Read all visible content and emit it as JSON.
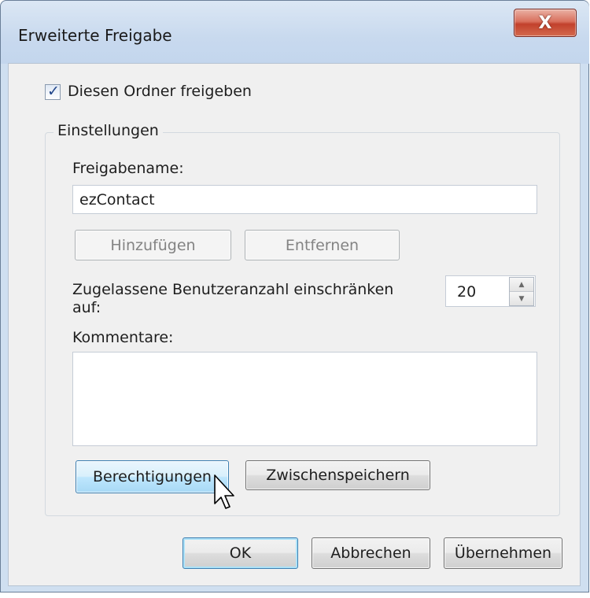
{
  "window": {
    "title": "Erweiterte Freigabe",
    "close_glyph": "X"
  },
  "share_checkbox": {
    "label": "Diesen Ordner freigeben",
    "checked": true
  },
  "settings": {
    "group_label": "Einstellungen",
    "share_name_label": "Freigabename:",
    "share_name_value": "ezContact",
    "add_button": "Hinzufügen",
    "remove_button": "Entfernen",
    "user_limit_label_line1": "Zugelassene Benutzeranzahl einschränken",
    "user_limit_label_line2": "auf:",
    "user_limit_value": "20",
    "comments_label": "Kommentare:",
    "comments_value": "",
    "permissions_button": "Berechtigungen",
    "caching_button": "Zwischenspeichern"
  },
  "footer": {
    "ok_button": "OK",
    "cancel_button": "Abbrechen",
    "apply_button": "Übernehmen"
  },
  "icons": {
    "checkmark": "check-icon",
    "spin_up": "arrow-up-icon",
    "spin_down": "arrow-down-icon",
    "cursor": "mouse-pointer-icon"
  }
}
